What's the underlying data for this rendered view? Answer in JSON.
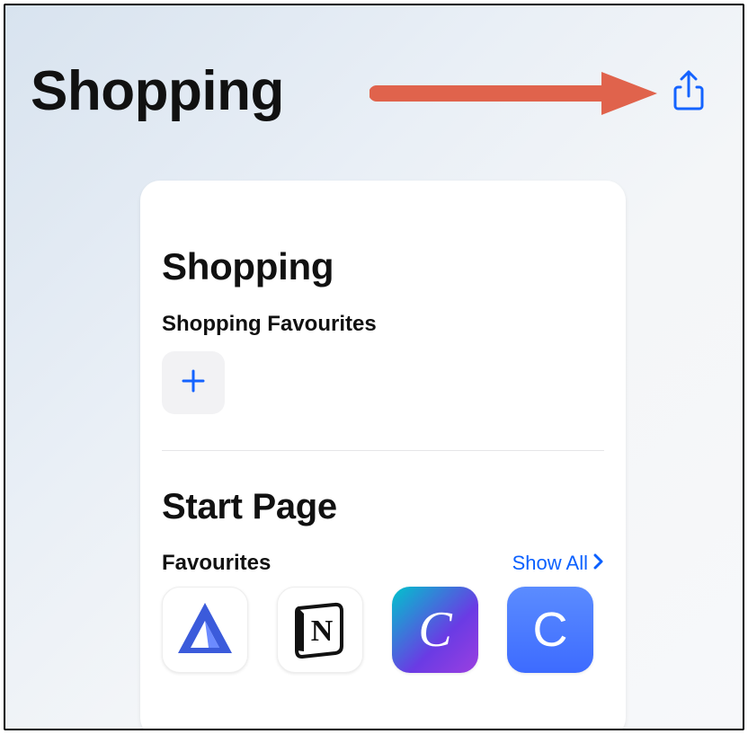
{
  "header": {
    "title": "Shopping"
  },
  "card": {
    "title": "Shopping",
    "favourites_label": "Shopping Favourites"
  },
  "start": {
    "title": "Start Page",
    "favourites_label": "Favourites",
    "show_all_label": "Show All"
  },
  "apps": [
    {
      "name": "adobe",
      "glyph": ""
    },
    {
      "name": "notion",
      "glyph": "N"
    },
    {
      "name": "canva",
      "glyph": "C"
    },
    {
      "name": "coinbase",
      "glyph": "C"
    }
  ],
  "colors": {
    "accent": "#1463ff",
    "arrow": "#e0634c"
  }
}
